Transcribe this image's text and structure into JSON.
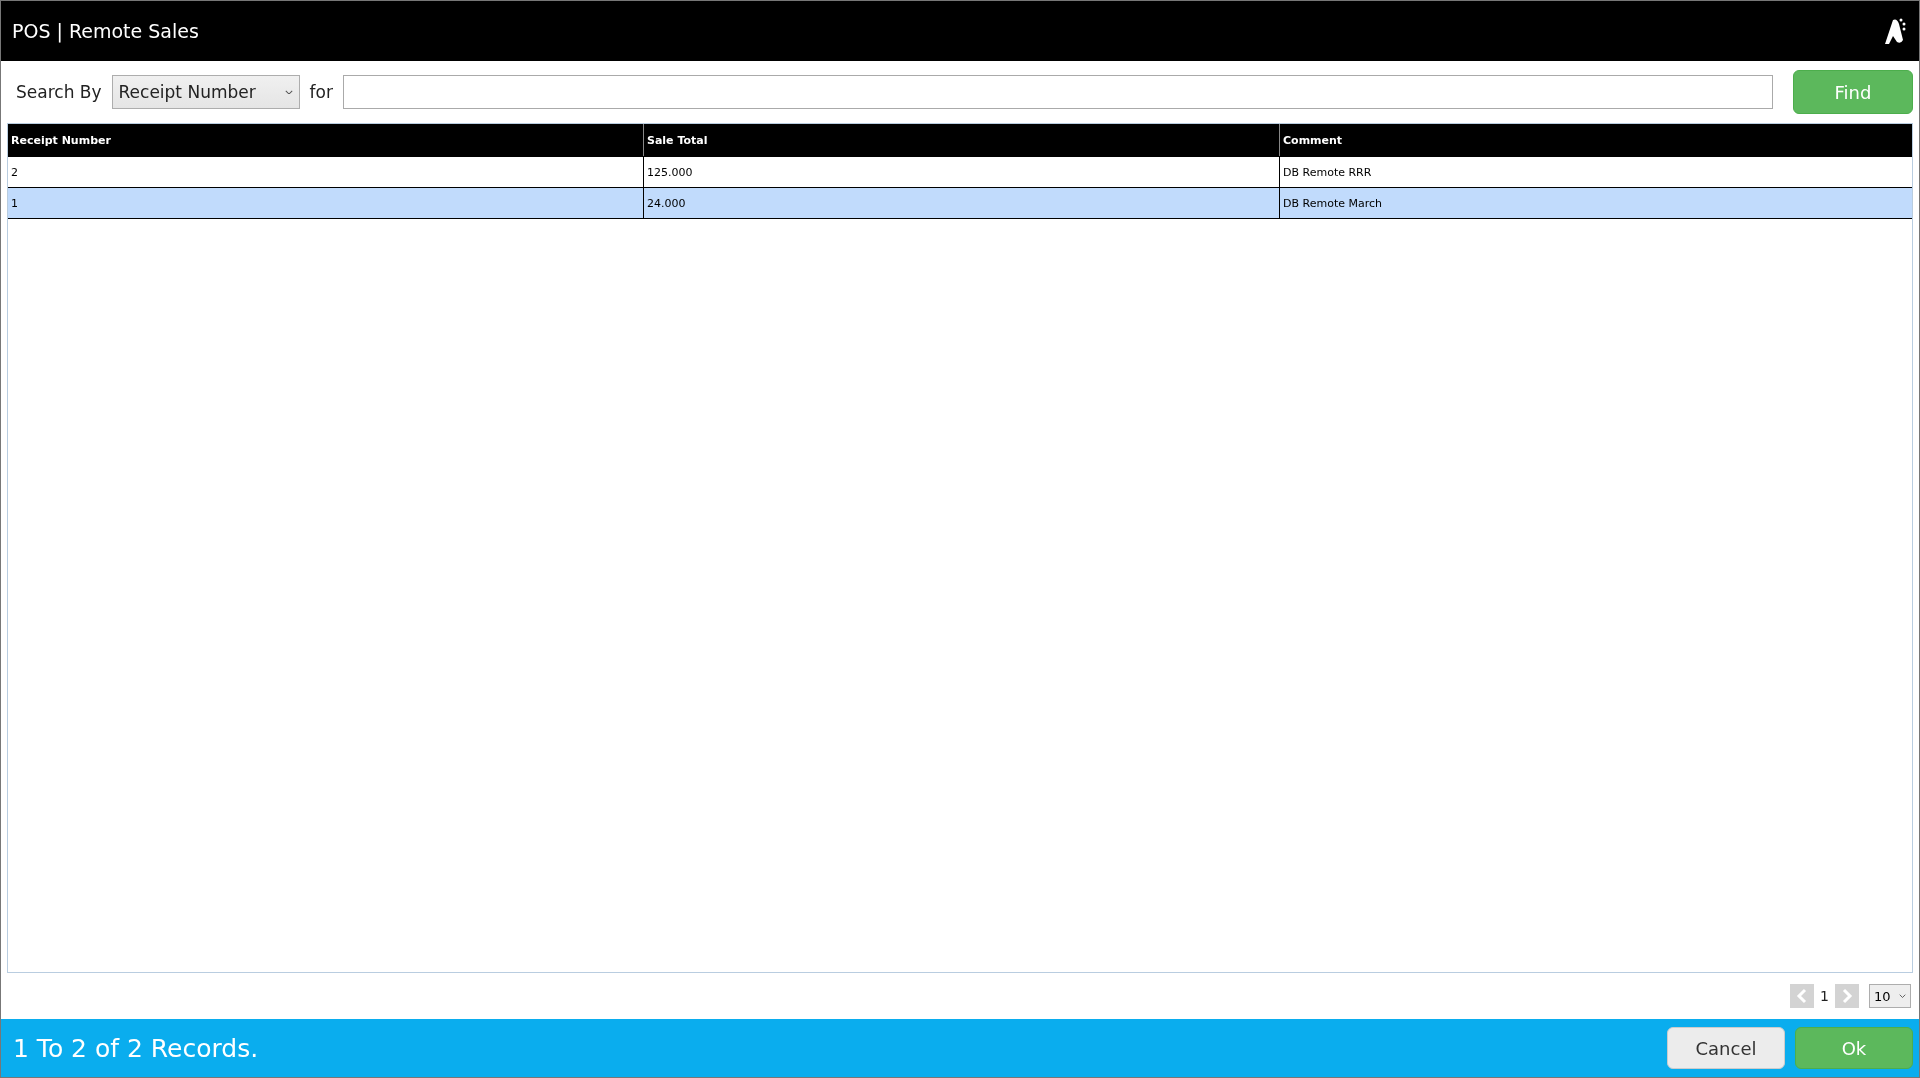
{
  "window": {
    "title": "POS | Remote Sales"
  },
  "search": {
    "label": "Search By",
    "field": "Receipt Number",
    "for_label": "for",
    "button": "Find"
  },
  "table": {
    "columns": [
      "Receipt Number",
      "Sale Total",
      "Comment"
    ],
    "rows": [
      {
        "cells": [
          "2",
          "125.000",
          "DB Remote RRR"
        ],
        "selected": false
      },
      {
        "cells": [
          "1",
          "24.000",
          "DB Remote March"
        ],
        "selected": true
      }
    ]
  },
  "pager": {
    "page": "1",
    "page_size": "10"
  },
  "status_bar": {
    "text": "1 To 2 of 2 Records.",
    "buttons": [
      {
        "label": "Cancel",
        "kind": "secondary"
      },
      {
        "label": "Ok",
        "kind": "primary"
      }
    ]
  }
}
